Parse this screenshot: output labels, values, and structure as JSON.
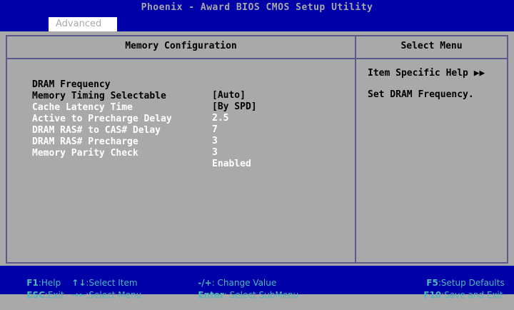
{
  "header": {
    "app_title": "Phoenix - Award BIOS CMOS Setup Utility",
    "active_tab": "Advanced"
  },
  "main_panel": {
    "title": "Memory Configuration",
    "items": [
      {
        "label": "DRAM Frequency",
        "value": "[Auto]",
        "editable": true
      },
      {
        "label": "Memory Timing Selectable",
        "value": "[By SPD]",
        "editable": true
      },
      {
        "label": "Cache Latency Time",
        "value": "2.5",
        "editable": false
      },
      {
        "label": "Active to Precharge Delay",
        "value": "7",
        "editable": false
      },
      {
        "label": "DRAM RAS# to CAS# Delay",
        "value": "3",
        "editable": false
      },
      {
        "label": "DRAM RAS# Precharge",
        "value": "3",
        "editable": false
      },
      {
        "label": "Memory Parity Check",
        "value": "Enabled",
        "editable": false
      }
    ]
  },
  "help_panel": {
    "title": "Select Menu",
    "header": "Item Specific Help ▶▶",
    "text": "Set DRAM Frequency."
  },
  "footer": {
    "keys": [
      {
        "key": "F1",
        "action": ":Help"
      },
      {
        "key": "ESC",
        "action": ":Exit"
      },
      {
        "key": "↑↓",
        "action": ":Select Item"
      },
      {
        "key": "→←",
        "action": ":Select Menu"
      },
      {
        "key": "-/+",
        "action": ": Change Value"
      },
      {
        "key": "Enter",
        "action": ": Select SubMenu"
      },
      {
        "key": "F5",
        "action": ":Setup Defaults"
      },
      {
        "key": "F10",
        "action": ":Save and Exit"
      }
    ]
  },
  "colors": {
    "background": "#a9a9a9",
    "bar": "#0000a8",
    "accent_text": "#4fb8b8",
    "border": "#5a5a8c",
    "editable_text": "#000000",
    "readonly_text": "#ffffff"
  }
}
